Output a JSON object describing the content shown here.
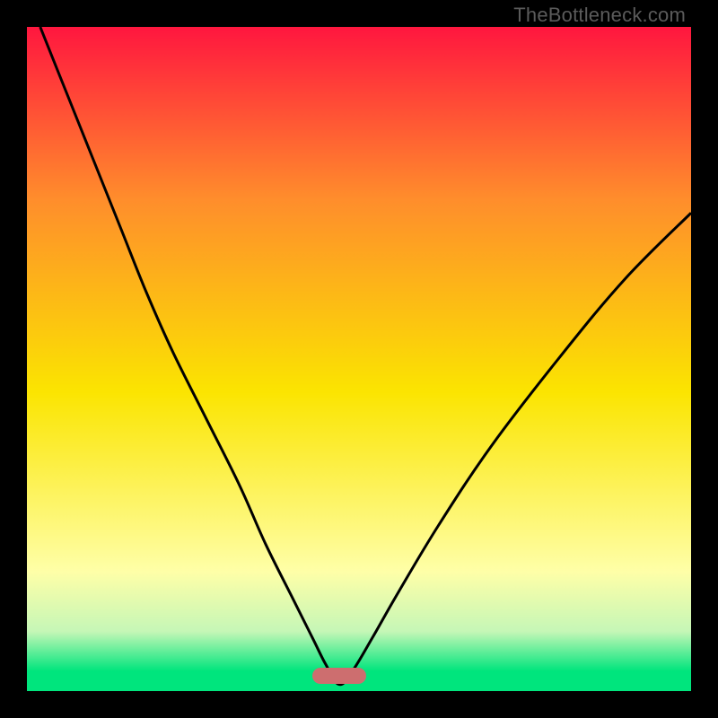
{
  "watermark": "TheBottleneck.com",
  "colors": {
    "red": "#ff173f",
    "orange": "#ff8e2c",
    "yellow": "#fbe501",
    "pale_yellow": "#ffffa8",
    "pale_green": "#c6f7b7",
    "green": "#00e57d",
    "tick": "#cd6e6f",
    "curve": "#000000",
    "frame": "#000000"
  },
  "gradient_stops": [
    {
      "offset": 0.0,
      "key": "red"
    },
    {
      "offset": 0.26,
      "key": "orange"
    },
    {
      "offset": 0.55,
      "key": "yellow"
    },
    {
      "offset": 0.82,
      "key": "pale_yellow"
    },
    {
      "offset": 0.91,
      "key": "pale_green"
    },
    {
      "offset": 0.97,
      "key": "green"
    },
    {
      "offset": 1.0,
      "key": "green"
    }
  ],
  "chart_data": {
    "type": "line",
    "title": "",
    "xlabel": "",
    "ylabel": "",
    "xlim": [
      0,
      100
    ],
    "ylim": [
      0,
      100
    ],
    "minimum_x": 47,
    "note": "V-shaped bottleneck curve; minimum near x≈47% where bottleneck ≈ 0",
    "series": [
      {
        "name": "bottleneck-curve",
        "x": [
          2,
          6,
          10,
          14,
          18,
          22,
          27,
          32,
          36,
          40,
          43,
          45,
          47,
          49,
          52,
          56,
          62,
          70,
          80,
          90,
          100
        ],
        "y": [
          100,
          90,
          80,
          70,
          60,
          51,
          41,
          31,
          22,
          14,
          8,
          4,
          1,
          3,
          8,
          15,
          25,
          37,
          50,
          62,
          72
        ]
      }
    ]
  },
  "layout": {
    "frame_inset": 30,
    "inner_size": 740,
    "tick_center_x_frac": 0.47
  }
}
